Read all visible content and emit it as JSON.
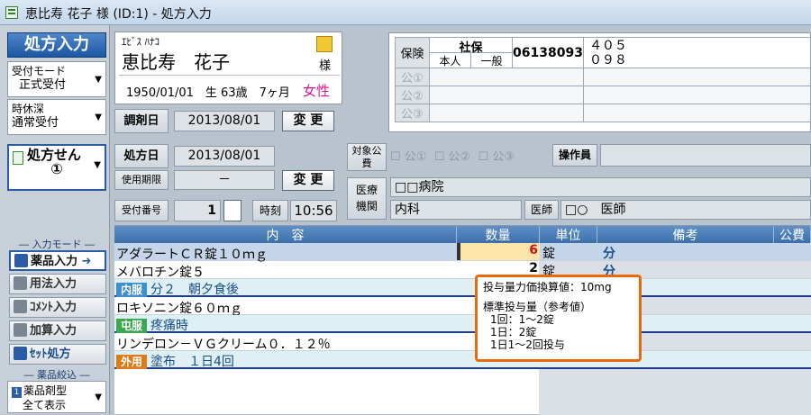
{
  "window": {
    "title": "恵比寿 花子 様 (ID:1) - 処方入力"
  },
  "left": {
    "main_button": "処方入力",
    "reception_mode_label": "受付モード",
    "reception_mode_value": "正式受付",
    "time_label": "時休深",
    "time_value": "通常受付",
    "prescription_label": "処方せん",
    "prescription_no": "①",
    "input_mode_header": "入力モード",
    "modes": [
      "薬品入力",
      "用法入力",
      "ｺﾒﾝﾄ入力",
      "加算入力",
      "ｾｯﾄ処方"
    ],
    "filter_header": "薬品絞込",
    "filter_label": "薬品剤型",
    "filter_value": "全て表示"
  },
  "patient": {
    "kana": "ｴﾋﾞｽ ﾊﾅｺ",
    "name": "恵比寿　花子",
    "honorific": "様",
    "birth": "1950/01/01　生 63歳　7ヶ月",
    "sex": "女性"
  },
  "dispense": {
    "label": "調剤日",
    "date": "2013/08/01",
    "change": "変 更"
  },
  "insurance": {
    "label": "保険",
    "type": "社保",
    "relation": "本人",
    "category": "一般",
    "number": "06138093",
    "code1": "４０５",
    "code2": "０９８",
    "public": [
      "公①",
      "公②",
      "公③"
    ]
  },
  "prescription": {
    "date_label": "処方日",
    "date": "2013/08/01",
    "expiry_label": "使用期限",
    "expiry": "－",
    "change": "変 更",
    "reception_no_label": "受付番号",
    "reception_no": "1",
    "time_label": "時刻",
    "time": "10:56"
  },
  "target": {
    "label": "対象公費",
    "options": [
      "公①",
      "公②",
      "公③"
    ],
    "operator_label": "操作員"
  },
  "clinic": {
    "label": "医療機関",
    "name": "□□病院",
    "dept": "内科",
    "doctor_label": "医師",
    "doctor": "□○　医師"
  },
  "grid": {
    "headers": [
      "内　容",
      "数量",
      "単位",
      "備考",
      "公費"
    ],
    "rows": [
      {
        "tag": "",
        "text": "アダラートＣＲ錠１０ｍｇ",
        "qty": "6",
        "unit": "錠",
        "note": "分",
        "selected": true
      },
      {
        "tag": "",
        "text": "メバロチン錠５",
        "qty": "2",
        "unit": "錠",
        "note": "分",
        "selected": false
      },
      {
        "tag": "内服",
        "text": "分２　朝夕食後",
        "qty": "",
        "unit": "",
        "note": "",
        "selected": false
      },
      {
        "tag": "",
        "text": "ロキソニン錠６０ｍｇ",
        "qty": "",
        "unit": "",
        "note": "",
        "selected": false
      },
      {
        "tag": "屯服",
        "text": "疼痛時",
        "qty": "",
        "unit": "",
        "note": "",
        "selected": false
      },
      {
        "tag": "",
        "text": "リンデロン－ＶＧクリーム０．１２％",
        "qty": "",
        "unit": "",
        "note": "",
        "selected": false
      },
      {
        "tag": "外用",
        "text": "塗布　１日4回",
        "qty": "",
        "unit": "",
        "note": "",
        "selected": false
      }
    ]
  },
  "tooltip": {
    "line1": "投与量力価換算値：10mg",
    "line2": "標準投与量（参考値）",
    "line3": "1回：1～2錠",
    "line4": "1日：2錠",
    "line5": "1日1～2回投与"
  },
  "colors": {
    "accent_blue": "#1c57a3",
    "tag_naifuku": "#3d8fd1",
    "tag_tonpuku": "#3aa84f",
    "tag_gaiyo": "#e07b1a",
    "female": "#e0148a",
    "tooltip_border": "#e86a10",
    "qty_red": "#d01414"
  }
}
